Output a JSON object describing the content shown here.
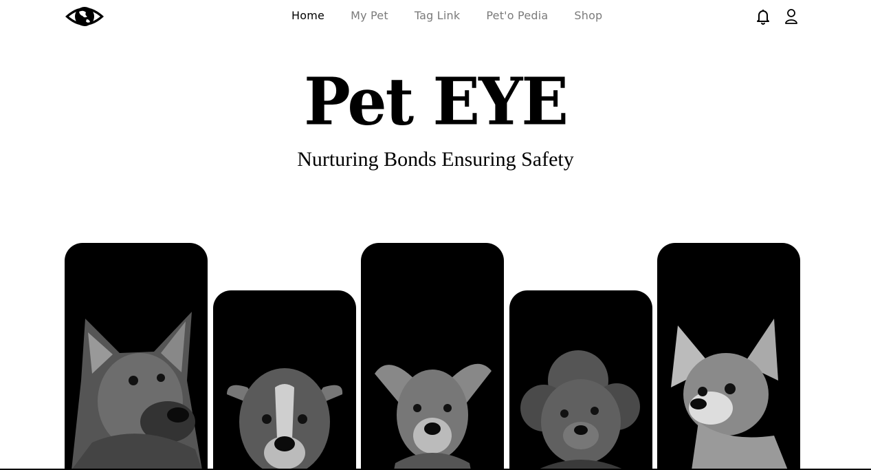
{
  "nav": {
    "links": [
      {
        "label": "Home",
        "active": true
      },
      {
        "label": "My Pet"
      },
      {
        "label": "Tag Link"
      },
      {
        "label": "Pet'o Pedia"
      },
      {
        "label": "Shop"
      }
    ],
    "icons": [
      "eye-logo-icon",
      "bell-icon",
      "user-icon"
    ]
  },
  "hero": {
    "title": "Pet EYE",
    "subtitle": "Nurturing Bonds Ensuring Safety"
  },
  "gallery": {
    "cards": [
      {
        "subject": "dog portrait"
      },
      {
        "subject": "dog portrait"
      },
      {
        "subject": "dog portrait"
      },
      {
        "subject": "poodle portrait"
      },
      {
        "subject": "chihuahua portrait"
      }
    ]
  }
}
